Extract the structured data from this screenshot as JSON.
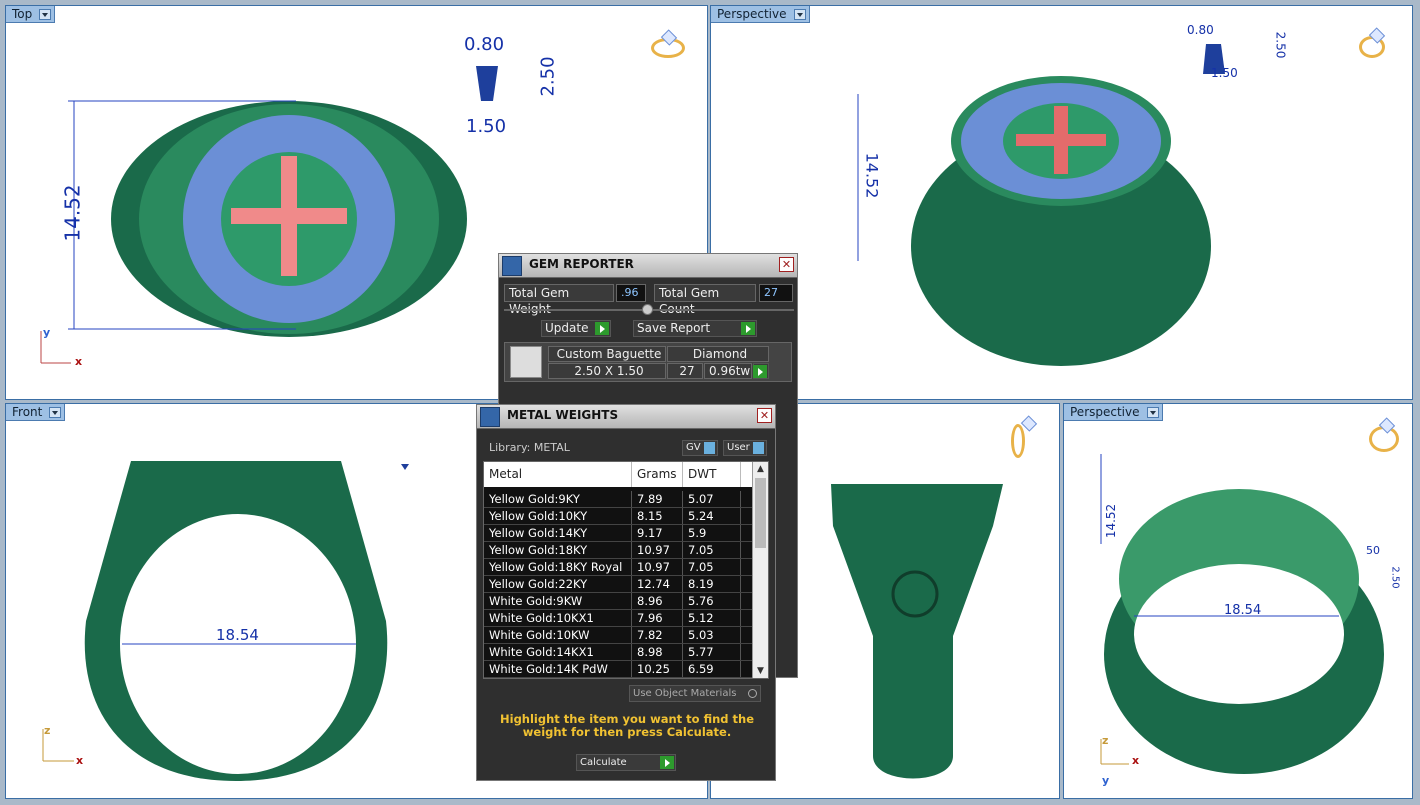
{
  "viewports": {
    "top": {
      "label": "Top",
      "dims": {
        "width": "0.80",
        "height": "2.50",
        "base": "1.50",
        "length": "14.52"
      },
      "axes": [
        "y",
        "x"
      ]
    },
    "persp1": {
      "label": "Perspective",
      "dims": {
        "width": "0.80",
        "height": "2.50",
        "base": "1.50",
        "length": "14.52"
      }
    },
    "front": {
      "label": "Front",
      "dims": {
        "inner": "18.54"
      },
      "axes": [
        "z",
        "x"
      ]
    },
    "persp2": {
      "label": "Perspective",
      "dims": {
        "length": "14.52",
        "inner": "18.54",
        "a": "50",
        "b": "2.50"
      },
      "axes": [
        "z",
        "x",
        "y"
      ]
    }
  },
  "gem_reporter": {
    "title": "GEM REPORTER",
    "total_weight_label": "Total Gem Weight",
    "total_weight": ".96",
    "total_count_label": "Total Gem Count",
    "total_count": "27",
    "update": "Update",
    "save_report": "Save Report",
    "row": {
      "shape": "Custom Baguette",
      "material": "Diamond",
      "size": "2.50 X 1.50",
      "count": "27",
      "weight": "0.96tw"
    }
  },
  "metal_weights": {
    "title": "METAL WEIGHTS",
    "library": "Library: METAL",
    "gv": "GV",
    "user": "User",
    "columns": [
      "Metal",
      "Grams",
      "DWT"
    ],
    "rows": [
      [
        "Yellow Gold:9KY",
        "7.89",
        "5.07"
      ],
      [
        "Yellow Gold:10KY",
        "8.15",
        "5.24"
      ],
      [
        "Yellow Gold:14KY",
        "9.17",
        "5.9"
      ],
      [
        "Yellow Gold:18KY",
        "10.97",
        "7.05"
      ],
      [
        "Yellow Gold:18KY Royal",
        "10.97",
        "7.05"
      ],
      [
        "Yellow Gold:22KY",
        "12.74",
        "8.19"
      ],
      [
        "White Gold:9KW",
        "8.96",
        "5.76"
      ],
      [
        "White Gold:10KX1",
        "7.96",
        "5.12"
      ],
      [
        "White Gold:10KW",
        "7.82",
        "5.03"
      ],
      [
        "White Gold:14KX1",
        "8.98",
        "5.77"
      ],
      [
        "White Gold:14K PdW",
        "10.25",
        "6.59"
      ]
    ],
    "use_object_materials": "Use Object Materials",
    "hint": "Highlight the item you want to find the weight for then press Calculate.",
    "calculate": "Calculate"
  }
}
